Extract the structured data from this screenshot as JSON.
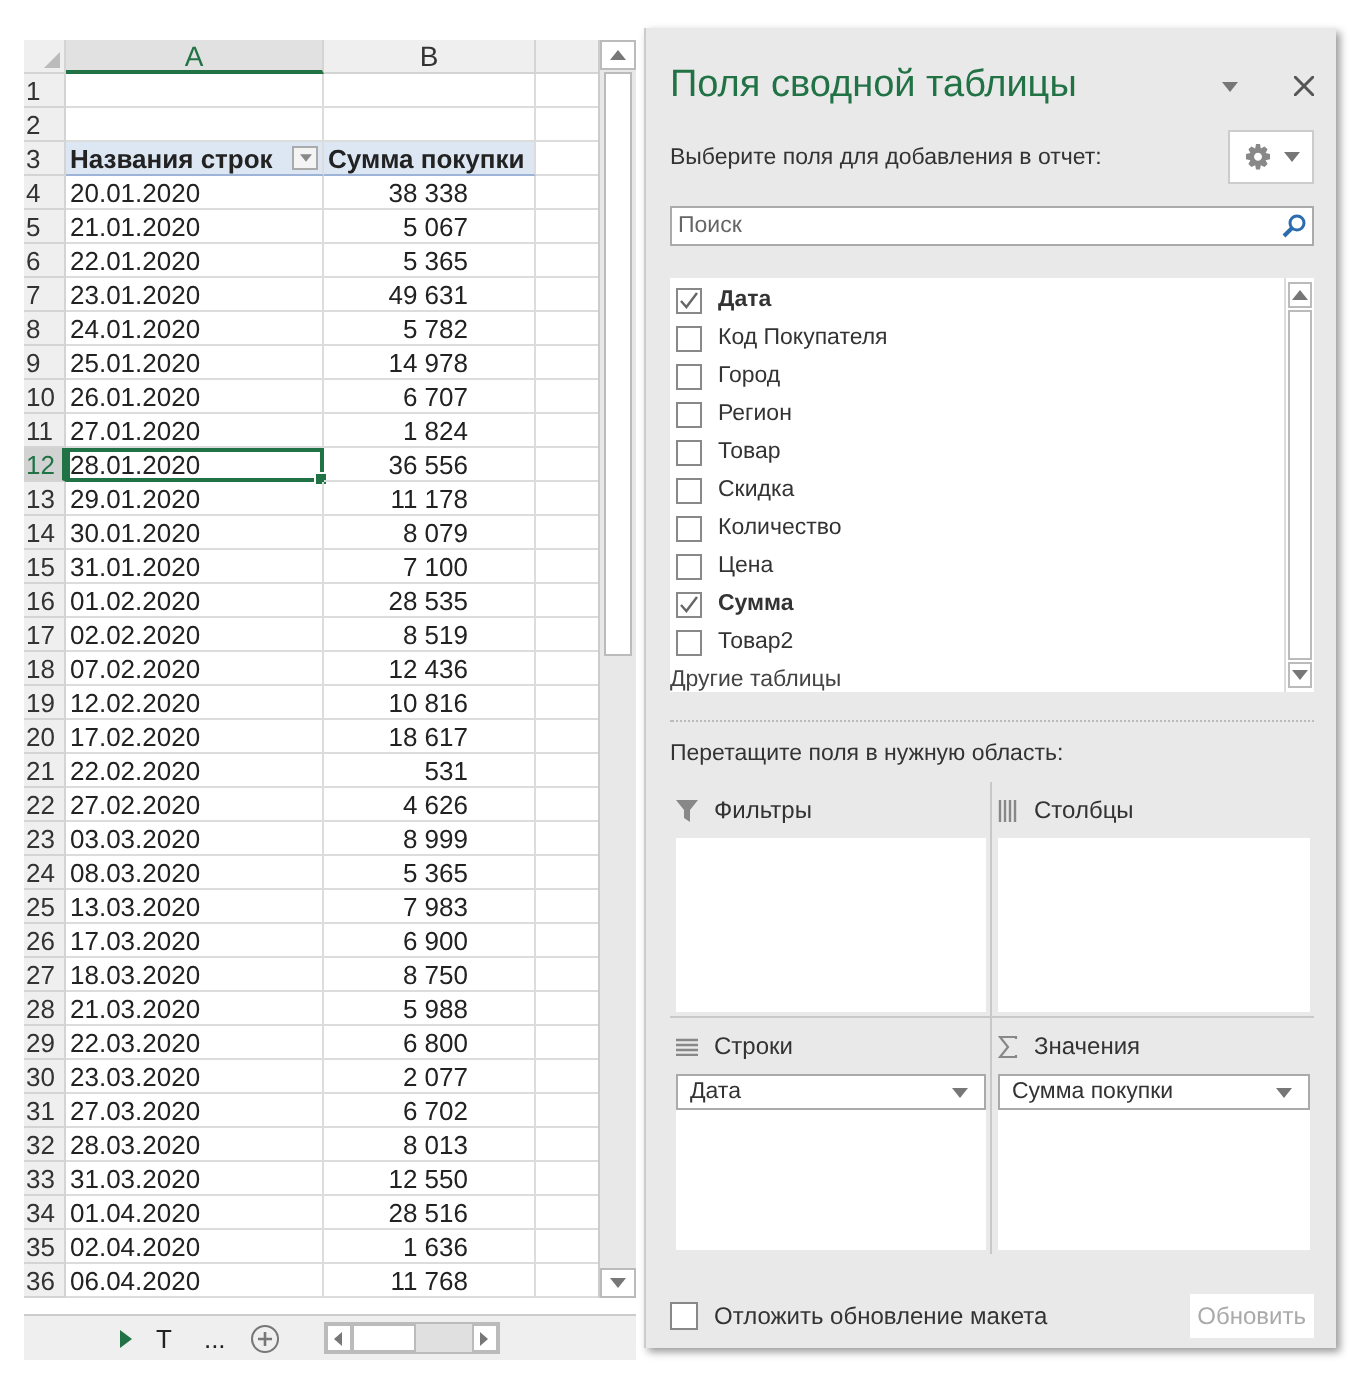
{
  "sheet": {
    "columns": [
      "A",
      "B"
    ],
    "row_numbers": [
      "1",
      "2",
      "3",
      "4",
      "5",
      "6",
      "7",
      "8",
      "9",
      "10",
      "11",
      "12",
      "13",
      "14",
      "15",
      "16",
      "17",
      "18",
      "19",
      "20",
      "21",
      "22",
      "23",
      "24",
      "25",
      "26",
      "27",
      "28",
      "29",
      "30",
      "31",
      "32",
      "33",
      "34",
      "35",
      "36"
    ],
    "header": {
      "label": "Названия строк",
      "value": "Сумма покупки"
    },
    "rows": [
      {
        "date": "20.01.2020",
        "sum": "38 338",
        "selected": false
      },
      {
        "date": "21.01.2020",
        "sum": "5 067",
        "selected": false
      },
      {
        "date": "22.01.2020",
        "sum": "5 365",
        "selected": false
      },
      {
        "date": "23.01.2020",
        "sum": "49 631",
        "selected": false
      },
      {
        "date": "24.01.2020",
        "sum": "5 782",
        "selected": false
      },
      {
        "date": "25.01.2020",
        "sum": "14 978",
        "selected": false
      },
      {
        "date": "26.01.2020",
        "sum": "6 707",
        "selected": false
      },
      {
        "date": "27.01.2020",
        "sum": "1 824",
        "selected": false
      },
      {
        "date": "28.01.2020",
        "sum": "36 556",
        "selected": true
      },
      {
        "date": "29.01.2020",
        "sum": "11 178",
        "selected": false
      },
      {
        "date": "30.01.2020",
        "sum": "8 079",
        "selected": false
      },
      {
        "date": "31.01.2020",
        "sum": "7 100",
        "selected": false
      },
      {
        "date": "01.02.2020",
        "sum": "28 535",
        "selected": false
      },
      {
        "date": "02.02.2020",
        "sum": "8 519",
        "selected": false
      },
      {
        "date": "07.02.2020",
        "sum": "12 436",
        "selected": false
      },
      {
        "date": "12.02.2020",
        "sum": "10 816",
        "selected": false
      },
      {
        "date": "17.02.2020",
        "sum": "18 617",
        "selected": false
      },
      {
        "date": "22.02.2020",
        "sum": "531",
        "selected": false
      },
      {
        "date": "27.02.2020",
        "sum": "4 626",
        "selected": false
      },
      {
        "date": "03.03.2020",
        "sum": "8 999",
        "selected": false
      },
      {
        "date": "08.03.2020",
        "sum": "5 365",
        "selected": false
      },
      {
        "date": "13.03.2020",
        "sum": "7 983",
        "selected": false
      },
      {
        "date": "17.03.2020",
        "sum": "6 900",
        "selected": false
      },
      {
        "date": "18.03.2020",
        "sum": "8 750",
        "selected": false
      },
      {
        "date": "21.03.2020",
        "sum": "5 988",
        "selected": false
      },
      {
        "date": "22.03.2020",
        "sum": "6 800",
        "selected": false
      },
      {
        "date": "23.03.2020",
        "sum": "2 077",
        "selected": false
      },
      {
        "date": "27.03.2020",
        "sum": "6 702",
        "selected": false
      },
      {
        "date": "28.03.2020",
        "sum": "8 013",
        "selected": false
      },
      {
        "date": "31.03.2020",
        "sum": "12 550",
        "selected": false
      },
      {
        "date": "01.04.2020",
        "sum": "28 516",
        "selected": false
      },
      {
        "date": "02.04.2020",
        "sum": "1 636",
        "selected": false
      },
      {
        "date": "06.04.2020",
        "sum": "11 768",
        "selected": false
      }
    ],
    "sheet_tabs": [
      "Т",
      "..."
    ]
  },
  "panel": {
    "title": "Поля сводной таблицы",
    "instruction": "Выберите поля для добавления в отчет:",
    "search": {
      "placeholder": "Поиск"
    },
    "fields": [
      {
        "label": "Дата",
        "checked": true
      },
      {
        "label": "Код Покупателя",
        "checked": false
      },
      {
        "label": "Город",
        "checked": false
      },
      {
        "label": "Регион",
        "checked": false
      },
      {
        "label": "Товар",
        "checked": false
      },
      {
        "label": "Скидка",
        "checked": false
      },
      {
        "label": "Количество",
        "checked": false
      },
      {
        "label": "Цена",
        "checked": false
      },
      {
        "label": "Сумма",
        "checked": true
      },
      {
        "label": "Товар2",
        "checked": false
      }
    ],
    "more_tables": "Другие таблицы",
    "drag_hint": "Перетащите поля в нужную область:",
    "areas": [
      {
        "kind": "filters",
        "title": "Фильтры"
      },
      {
        "kind": "columns",
        "title": "Столбцы"
      },
      {
        "kind": "rows",
        "title": "Строки",
        "items": [
          "Дата"
        ]
      },
      {
        "kind": "values",
        "title": "Значения",
        "items": [
          "Сумма покупки"
        ]
      }
    ],
    "defer": {
      "label": "Отложить обновление макета",
      "checked": false
    },
    "update_button": {
      "label": "Обновить",
      "disabled": true
    }
  }
}
